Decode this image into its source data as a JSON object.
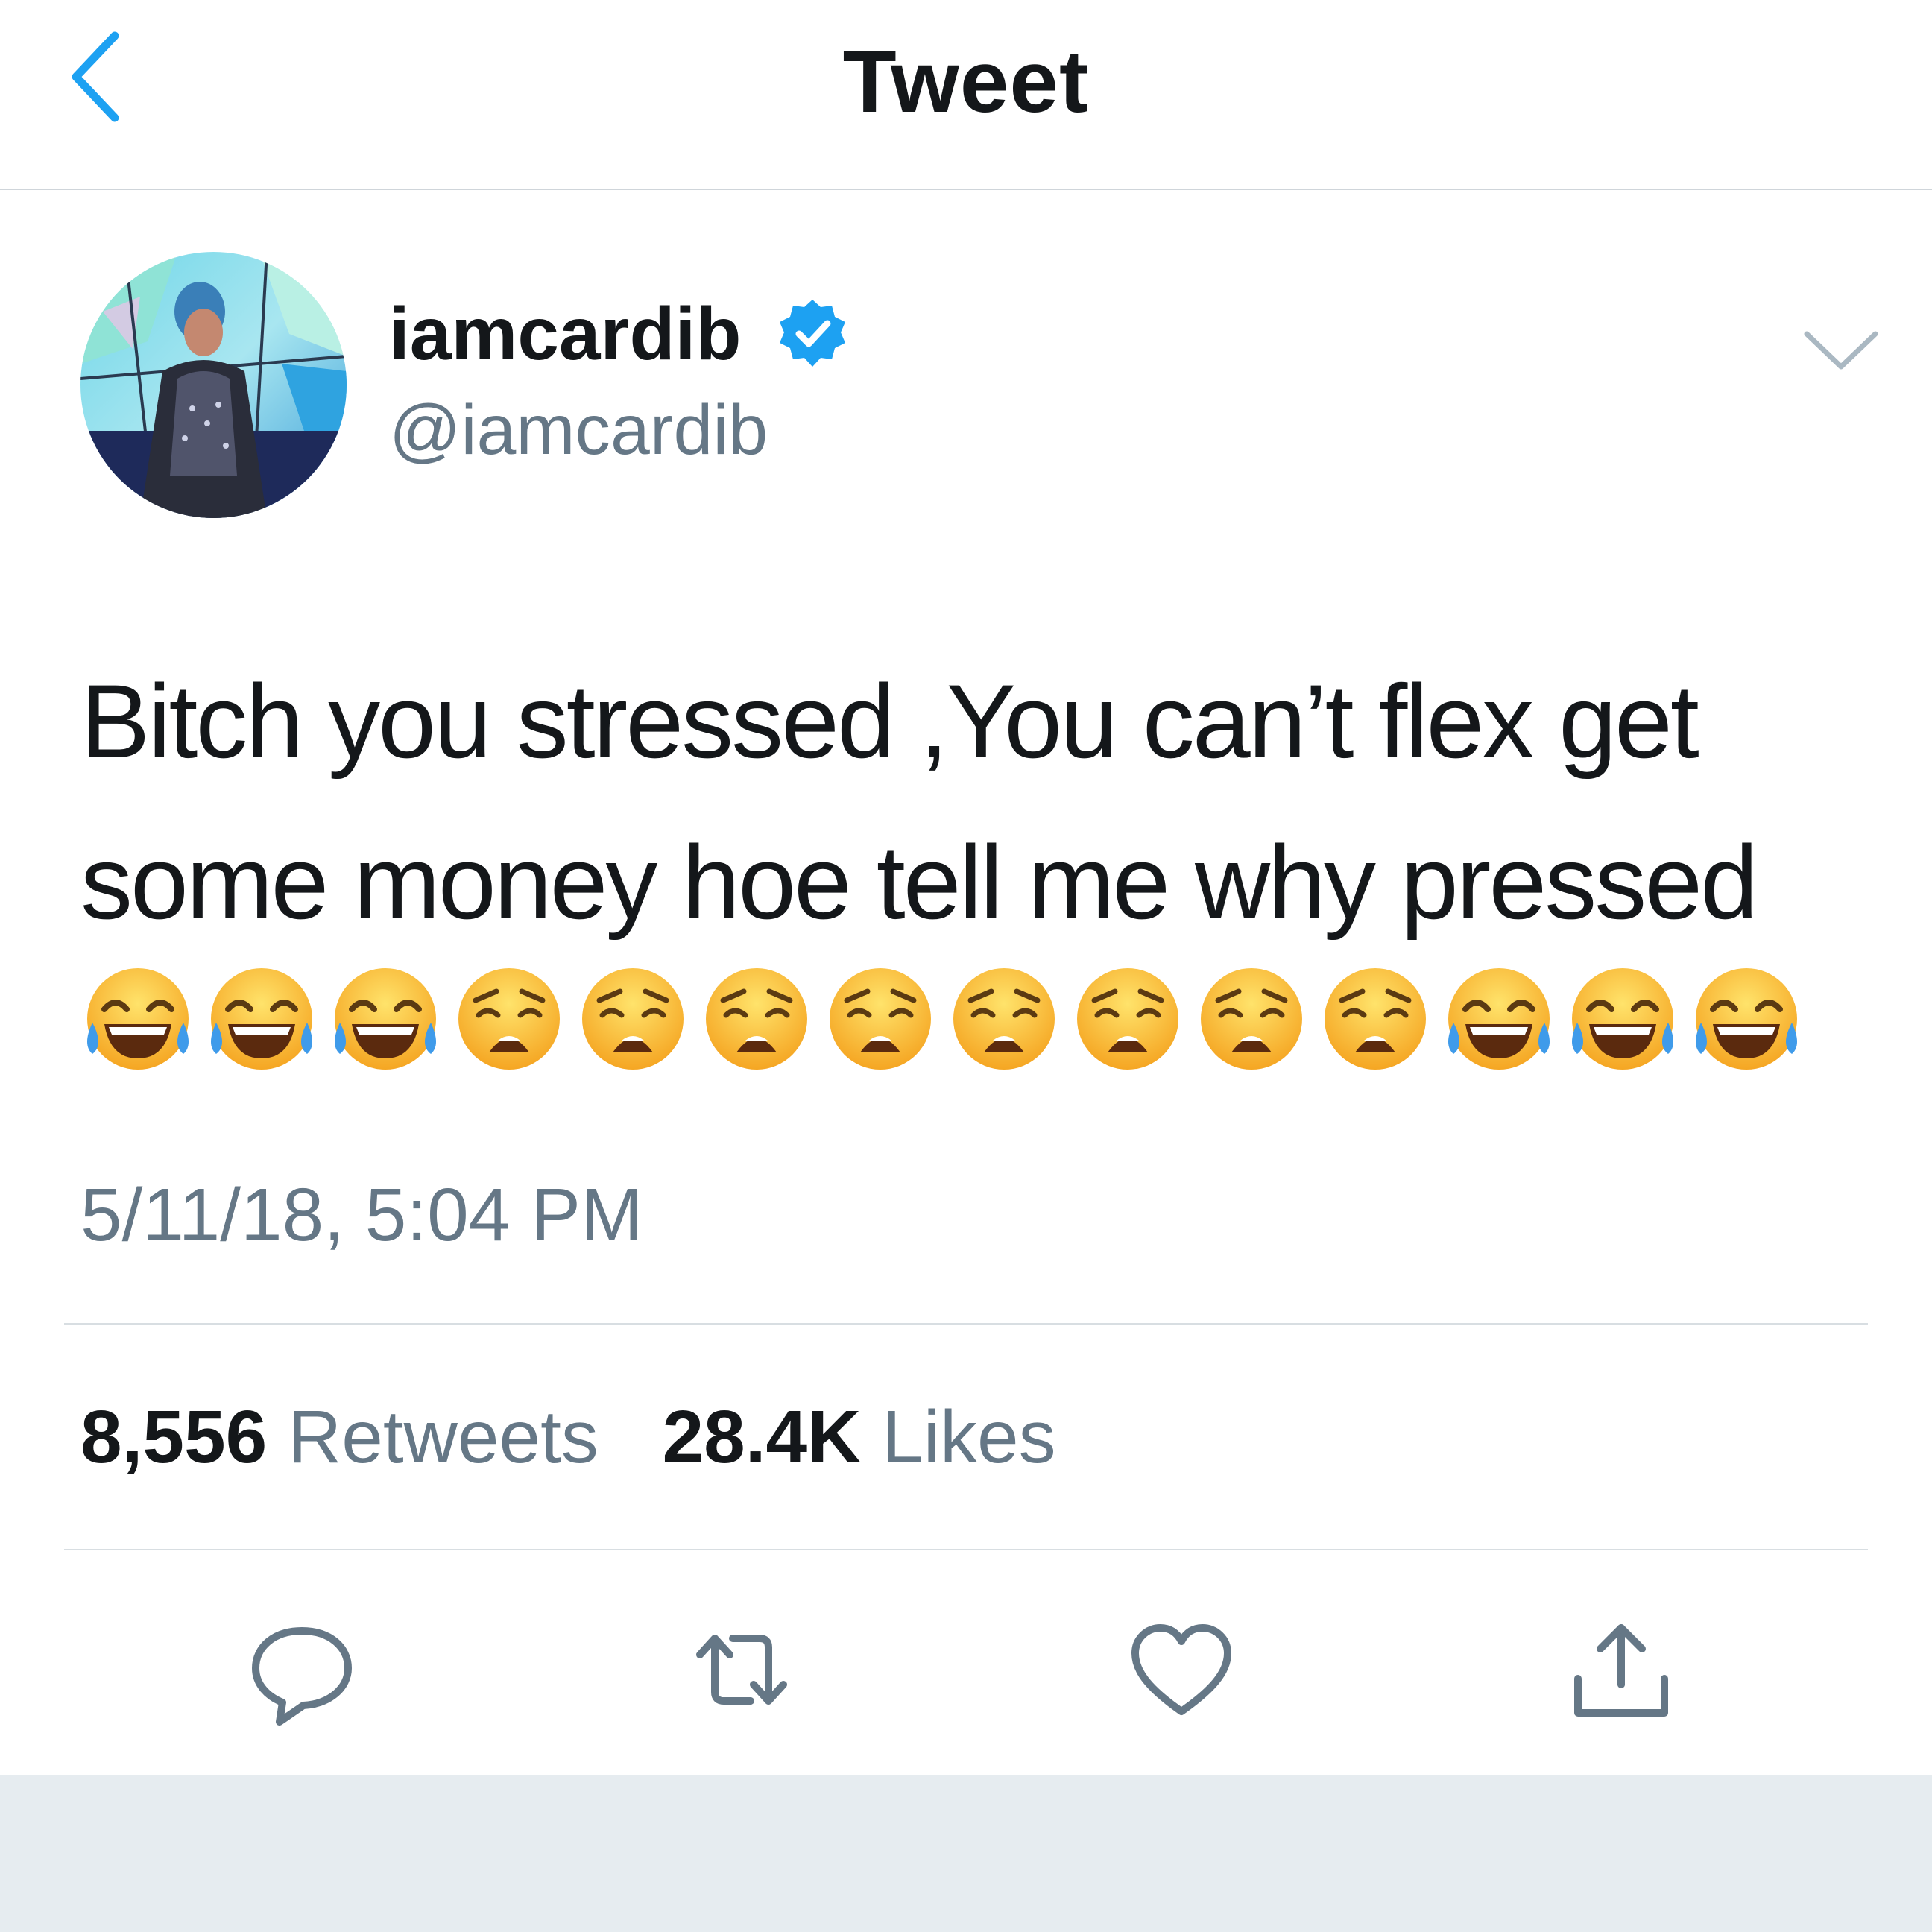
{
  "header": {
    "title": "Tweet",
    "back_icon": "chevron-left-icon"
  },
  "author": {
    "display_name": "iamcardib",
    "handle": "@iamcardib",
    "verified": true
  },
  "tweet": {
    "lines": [
      "Bitch you stressed ,You can’t flex get",
      "some money hoe tell me why pressed"
    ],
    "emojis": [
      "😂",
      "😂",
      "😂",
      "😩",
      "😩",
      "😩",
      "😩",
      "😩",
      "😩",
      "😩",
      "😩",
      "😂",
      "😂",
      "😂"
    ],
    "timestamp": "5/11/18, 5:04 PM"
  },
  "stats": {
    "retweets_count": "8,556",
    "retweets_label": "Retweets",
    "likes_count": "28.4K",
    "likes_label": "Likes"
  },
  "actions": [
    "reply-icon",
    "retweet-icon",
    "like-icon",
    "share-icon"
  ],
  "colors": {
    "accent": "#1da1f2",
    "text_primary": "#14171a",
    "text_secondary": "#657786",
    "divider": "#d8dee2",
    "footer_bg": "#e6ecf0"
  }
}
